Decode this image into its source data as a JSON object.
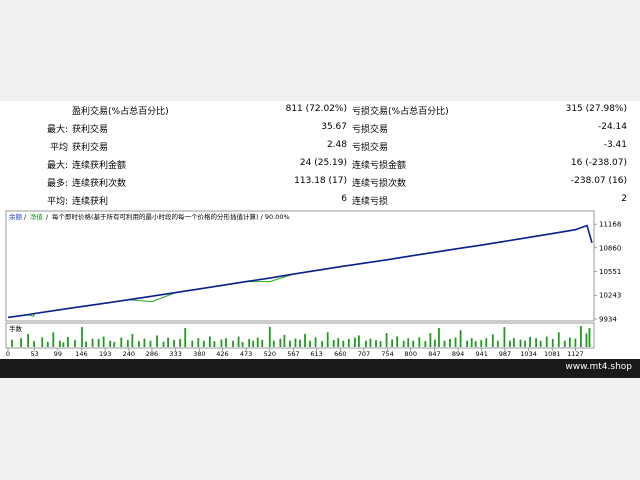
{
  "stats": {
    "rows": [
      {
        "c1": "",
        "c2": "盈利交易(%占总百分比)",
        "c3": "811 (72.02%)",
        "c4": "亏损交易(%占总百分比)",
        "c5": "315 (27.98%)"
      },
      {
        "c1": "最大:",
        "c2": "获利交易",
        "c3": "35.67",
        "c4": "亏损交易",
        "c5": "-24.14"
      },
      {
        "c1": "平均",
        "c2": "获利交易",
        "c3": "2.48",
        "c4": "亏损交易",
        "c5": "-3.41"
      },
      {
        "c1": "最大:",
        "c2": "连续获利金额",
        "c3": "24 (25.19)",
        "c4": "连续亏损金额",
        "c5": "16 (-238.07)"
      },
      {
        "c1": "最多:",
        "c2": "连续获利次数",
        "c3": "113.18 (17)",
        "c4": "连续亏损次数",
        "c5": "-238.07 (16)"
      },
      {
        "c1": "平均:",
        "c2": "连续获利",
        "c3": "6",
        "c4": "连续亏损",
        "c5": "2"
      }
    ]
  },
  "chart_header": {
    "balance_label": "余额",
    "equity_label": "净值",
    "lot_label": "每个即时价格(基于所有可利用的最小时段的每一个价格的分形插值计算) / 90.00%"
  },
  "volume_label": "手数",
  "colors": {
    "balance_line": "#0b1f8f",
    "equity_line": "#22aa22",
    "volume_bars": "#1f9a1f"
  },
  "chart_data": {
    "type": "line",
    "title": "",
    "ylabel": "",
    "xlabel": "",
    "ylim": [
      9934,
      11300
    ],
    "y_ticks": [
      11168,
      10860,
      10551,
      10243,
      9934
    ],
    "x_ticks": [
      0,
      53,
      99,
      146,
      193,
      240,
      286,
      333,
      380,
      426,
      473,
      520,
      567,
      613,
      660,
      707,
      754,
      800,
      847,
      894,
      941,
      987,
      1034,
      1081,
      1127
    ],
    "xlim": [
      0,
      1160
    ],
    "series": [
      {
        "name": "余额",
        "x": [
          0,
          40,
          53,
          99,
          146,
          193,
          240,
          286,
          333,
          380,
          426,
          473,
          520,
          567,
          613,
          660,
          707,
          754,
          800,
          847,
          894,
          941,
          987,
          1034,
          1081,
          1127,
          1150,
          1160
        ],
        "values": [
          9955,
          9990,
          10005,
          10050,
          10095,
          10140,
          10185,
          10230,
          10278,
          10326,
          10372,
          10420,
          10466,
          10518,
          10566,
          10614,
          10660,
          10706,
          10755,
          10802,
          10850,
          10895,
          10945,
          10996,
          11045,
          11096,
          11150,
          10925
        ]
      },
      {
        "name": "净值",
        "x": [
          0,
          40,
          50,
          53,
          99,
          146,
          193,
          240,
          286,
          333,
          380,
          426,
          473,
          520,
          567,
          613,
          660,
          707,
          754,
          800,
          847,
          894,
          941,
          987,
          1034,
          1081,
          1127,
          1150,
          1160
        ],
        "values": [
          9955,
          9990,
          9968,
          10005,
          10050,
          10095,
          10140,
          10185,
          10160,
          10278,
          10326,
          10372,
          10420,
          10420,
          10518,
          10566,
          10614,
          10660,
          10706,
          10755,
          10802,
          10850,
          10895,
          10945,
          10996,
          11045,
          11096,
          11150,
          10925
        ]
      }
    ],
    "volume": {
      "name": "手数",
      "ylim": [
        0,
        1
      ],
      "x": [
        8,
        26,
        40,
        52,
        68,
        79,
        90,
        103,
        110,
        119,
        133,
        147,
        155,
        168,
        180,
        190,
        203,
        211,
        225,
        238,
        247,
        260,
        271,
        283,
        296,
        309,
        318,
        330,
        342,
        352,
        366,
        378,
        389,
        401,
        410,
        424,
        433,
        447,
        458,
        466,
        479,
        487,
        496,
        505,
        520,
        528,
        541,
        549,
        560,
        571,
        580,
        590,
        600,
        611,
        624,
        635,
        647,
        656,
        666,
        677,
        689,
        697,
        711,
        720,
        731,
        740,
        752,
        763,
        773,
        786,
        795,
        805,
        817,
        829,
        839,
        848,
        856,
        867,
        878,
        889,
        899,
        912,
        921,
        929,
        940,
        950,
        963,
        973,
        986,
        997,
        1005,
        1018,
        1027,
        1037,
        1049,
        1058,
        1070,
        1082,
        1094,
        1106,
        1116,
        1127,
        1138,
        1149,
        1155
      ],
      "values": [
        0.35,
        0.42,
        0.62,
        0.28,
        0.46,
        0.25,
        0.7,
        0.3,
        0.22,
        0.48,
        0.33,
        0.95,
        0.26,
        0.4,
        0.38,
        0.5,
        0.3,
        0.24,
        0.45,
        0.33,
        0.62,
        0.28,
        0.4,
        0.3,
        0.55,
        0.26,
        0.45,
        0.34,
        0.38,
        0.9,
        0.3,
        0.42,
        0.3,
        0.5,
        0.28,
        0.36,
        0.42,
        0.3,
        0.5,
        0.24,
        0.38,
        0.3,
        0.45,
        0.34,
        0.96,
        0.3,
        0.4,
        0.58,
        0.3,
        0.4,
        0.35,
        0.62,
        0.3,
        0.46,
        0.28,
        0.7,
        0.34,
        0.42,
        0.3,
        0.38,
        0.45,
        0.55,
        0.3,
        0.4,
        0.33,
        0.28,
        0.66,
        0.36,
        0.5,
        0.3,
        0.42,
        0.3,
        0.46,
        0.28,
        0.66,
        0.35,
        0.9,
        0.3,
        0.38,
        0.45,
        0.8,
        0.3,
        0.42,
        0.28,
        0.33,
        0.42,
        0.6,
        0.3,
        0.95,
        0.3,
        0.42,
        0.35,
        0.3,
        0.48,
        0.42,
        0.3,
        0.5,
        0.38,
        0.7,
        0.3,
        0.45,
        0.4,
        1.0,
        0.65,
        0.9
      ]
    }
  },
  "footer": {
    "watermark": "www.mt4.shop"
  }
}
